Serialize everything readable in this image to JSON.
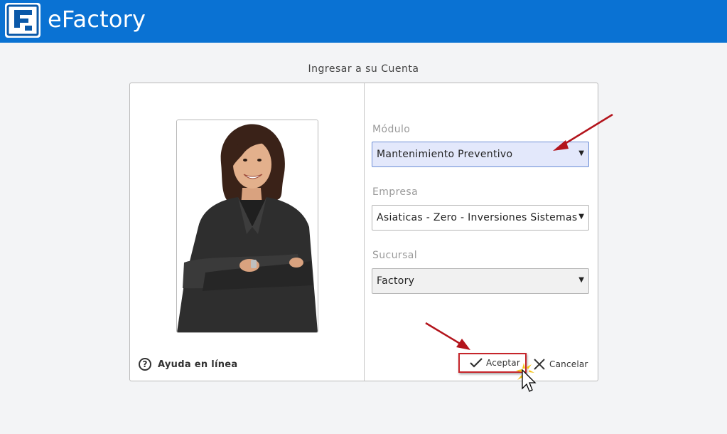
{
  "app": {
    "title": "eFactory",
    "logo_icon": "efactory-logo-icon",
    "brand_color": "#0a72d3"
  },
  "login": {
    "title": "Ingresar a su Cuenta",
    "help_label": "Ayuda en línea",
    "help_icon": "question-circle-icon",
    "photo": "businesswoman-photo"
  },
  "form": {
    "modulo": {
      "label": "Módulo",
      "value": "Mantenimiento Preventivo"
    },
    "empresa": {
      "label": "Empresa",
      "value": "Asiaticas - Zero - Inversiones Sistemas"
    },
    "sucursal": {
      "label": "Sucursal",
      "value": "Factory"
    }
  },
  "buttons": {
    "accept": {
      "label": "Aceptar",
      "icon": "check-icon"
    },
    "cancel": {
      "label": "Cancelar",
      "icon": "close-icon"
    }
  },
  "annotations": {
    "arrow_color": "#b3141c",
    "highlight_color": "#c6252b"
  }
}
